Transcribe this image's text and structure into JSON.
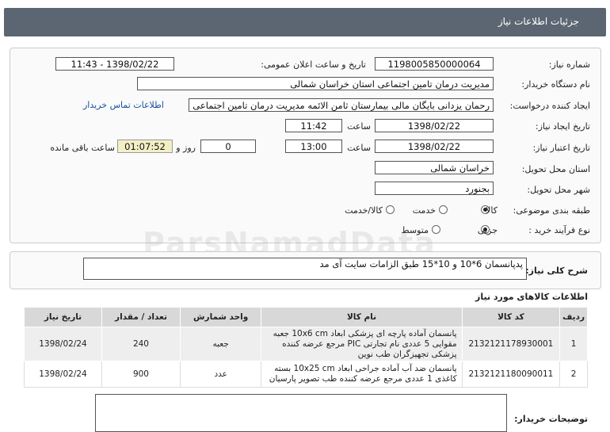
{
  "header": {
    "title": "جزئیات اطلاعات نیاز"
  },
  "form": {
    "need_number_label": "شماره نیاز:",
    "need_number": "1198005850000064",
    "announce_label": "تاریخ و ساعت اعلان عمومی:",
    "announce_value": "1398/02/22 - 11:43",
    "buyer_org_label": "نام دستگاه خریدار:",
    "buyer_org": "مدیریت درمان تامین اجتماعی استان خراسان شمالی",
    "requester_label": "ایجاد کننده درخواست:",
    "requester": "رحمان یزدانی بایگان مالی بیمارستان ثامن الائمه مدیریت درمان تامین اجتماعی ا",
    "contact_link": "اطلاعات تماس خریدار",
    "created_label": "تاریخ ایجاد نیاز:",
    "created_date": "1398/02/22",
    "time_label": "ساعت",
    "created_time": "11:42",
    "valid_label": "تاریخ اعتبار نیاز:",
    "valid_date": "1398/02/22",
    "valid_time": "13:00",
    "days_value": "0",
    "days_label": "روز و",
    "remaining_time": "01:07:52",
    "remaining_label": "ساعت باقی مانده",
    "province_label": "استان محل تحویل:",
    "province": "خراسان شمالی",
    "city_label": "شهر محل تحویل:",
    "city": "بجنورد",
    "category_label": "طبقه بندی موضوعی:",
    "category_options": [
      "کالا",
      "خدمت",
      "کالا/خدمت"
    ],
    "category_selected": "کالا",
    "process_label": "نوع فرآیند خرید :",
    "process_options": [
      "جزیی",
      "متوسط"
    ],
    "process_selected": "جزیی"
  },
  "summary": {
    "label": "شرح کلی نیاز:",
    "value": "پدپانسمان 6*10 و 10*15 طبق الزامات سایت آی مد"
  },
  "goods": {
    "section_title": "اطلاعات کالاهای مورد نیاز",
    "columns": [
      "ردیف",
      "کد کالا",
      "نام کالا",
      "واحد شمارش",
      "تعداد / مقدار",
      "تاریخ نیاز"
    ],
    "rows": [
      {
        "idx": "1",
        "code": "2132121178930001",
        "name": "پانسمان آماده پارچه ای پزشکی ابعاد 10x6 cm جعبه مقوایی 5 عددی نام تجارتی PIC مرجع عرضه کننده پزشکی تجهیزگران طب نوین",
        "unit": "جعبه",
        "qty": "240",
        "date": "1398/02/24"
      },
      {
        "idx": "2",
        "code": "2132121180090011",
        "name": "پانسمان ضد آب آماده جراحی ابعاد 10x25 cm بسته کاغذی 1 عددی مرجع عرضه کننده طب تصویر پارسیان",
        "unit": "عدد",
        "qty": "900",
        "date": "1398/02/24"
      }
    ]
  },
  "buyer_notes": {
    "label": "توضیحات خریدار:",
    "value": ""
  },
  "watermark": {
    "text": "ParsNamadData"
  }
}
